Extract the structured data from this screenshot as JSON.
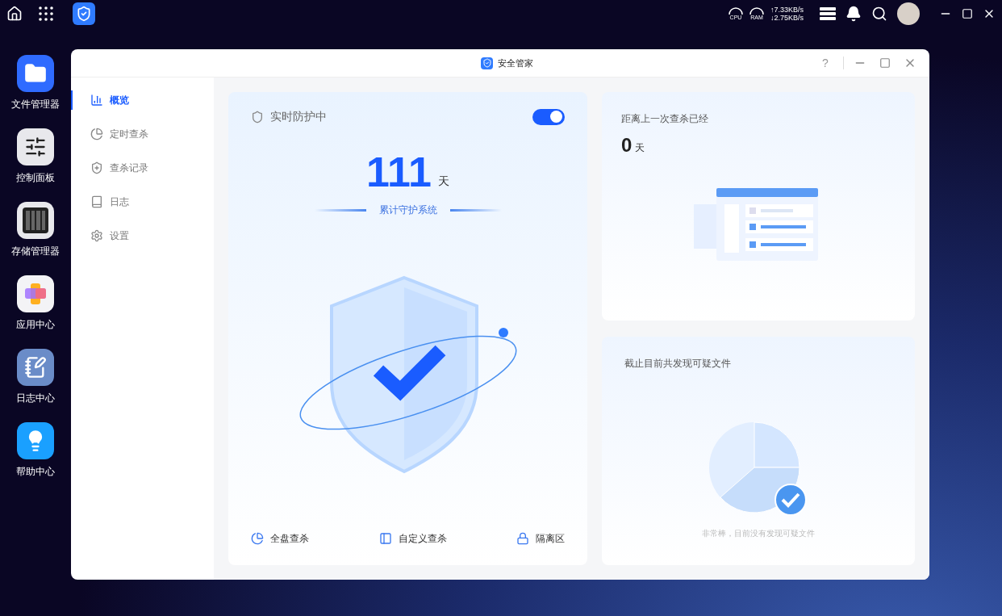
{
  "top_bar": {
    "cpu_label": "CPU",
    "ram_label": "RAM",
    "upload": "↑7.33KB/s",
    "download": "↓2.75KB/s"
  },
  "dock": [
    {
      "label": "文件管理器",
      "kind": "files"
    },
    {
      "label": "控制面板",
      "kind": "control"
    },
    {
      "label": "存储管理器",
      "kind": "storage"
    },
    {
      "label": "应用中心",
      "kind": "apps"
    },
    {
      "label": "日志中心",
      "kind": "logs"
    },
    {
      "label": "帮助中心",
      "kind": "help"
    }
  ],
  "window": {
    "title": "安全管家",
    "help": "?"
  },
  "sidebar": {
    "items": [
      {
        "label": "概览",
        "kind": "overview",
        "selected": true
      },
      {
        "label": "定时查杀",
        "kind": "schedule",
        "selected": false
      },
      {
        "label": "查杀记录",
        "kind": "records",
        "selected": false
      },
      {
        "label": "日志",
        "kind": "log",
        "selected": false
      },
      {
        "label": "设置",
        "kind": "settings",
        "selected": false
      }
    ]
  },
  "protection": {
    "label": "实时防护中",
    "on": true,
    "days": "111",
    "unit": "天",
    "caption": "累计守护系统",
    "actions": [
      {
        "label": "全盘查杀",
        "kind": "full"
      },
      {
        "label": "自定义查杀",
        "kind": "custom"
      },
      {
        "label": "隔离区",
        "kind": "quarantine"
      }
    ]
  },
  "last_scan": {
    "title": "距离上一次查杀已经",
    "value": "0",
    "unit": "天"
  },
  "suspicious": {
    "title": "截止目前共发现可疑文件",
    "message": "非常棒，目前没有发现可疑文件"
  }
}
